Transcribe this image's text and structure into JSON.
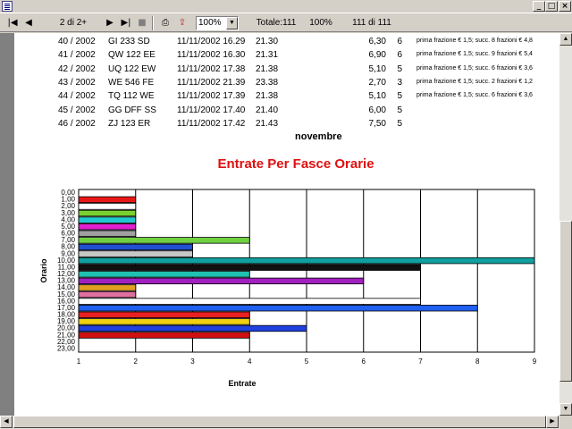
{
  "window": {
    "minimize": "_",
    "maximize": "□",
    "close": "×"
  },
  "toolbar": {
    "first_icon": "first-page-icon",
    "prev_icon": "prev-page-icon",
    "page_indicator": "2 di 2+",
    "next_icon": "next-page-icon",
    "last_icon": "last-page-icon",
    "stop_icon": "stop-icon",
    "print_icon": "print-icon",
    "export_icon": "export-icon",
    "zoom": "100%",
    "total": "Totale:111",
    "percent": "100%",
    "records": "111 di 111"
  },
  "rows": [
    {
      "id": "40 / 2002",
      "plate": "GI 233 SD",
      "datetime": "11/11/2002 16.29",
      "out": "21.30",
      "amount": "6,30",
      "n": "6",
      "note": "prima frazione € 1,5; succ. 8 frazioni € 4,8"
    },
    {
      "id": "41 / 2002",
      "plate": "QW 122 EE",
      "datetime": "11/11/2002 16.30",
      "out": "21.31",
      "amount": "6,90",
      "n": "6",
      "note": "prima frazione € 1,5; succ. 9 frazioni € 5,4"
    },
    {
      "id": "42 / 2002",
      "plate": "UQ 122 EW",
      "datetime": "11/11/2002 17.38",
      "out": "21.38",
      "amount": "5,10",
      "n": "5",
      "note": "prima frazione € 1,5; succ. 6 frazioni € 3,6"
    },
    {
      "id": "43 / 2002",
      "plate": "WE 546 FE",
      "datetime": "11/11/2002 21.39",
      "out": "23.38",
      "amount": "2,70",
      "n": "3",
      "note": "prima frazione € 1,5; succ. 2 frazioni € 1,2"
    },
    {
      "id": "44 / 2002",
      "plate": "TQ 112 WE",
      "datetime": "11/11/2002 17.39",
      "out": "21.38",
      "amount": "5,10",
      "n": "5",
      "note": "prima frazione € 1,5; succ. 6 frazioni € 3,6"
    },
    {
      "id": "45 / 2002",
      "plate": "GG DFF SS",
      "datetime": "11/11/2002 17.40",
      "out": "21.40",
      "amount": "6,00",
      "n": "5",
      "note": ""
    },
    {
      "id": "46 / 2002",
      "plate": "ZJ 123 ER",
      "datetime": "11/11/2002 17.42",
      "out": "21.43",
      "amount": "7,50",
      "n": "5",
      "note": ""
    }
  ],
  "month_label": "novembre",
  "chart_data": {
    "type": "bar",
    "orientation": "horizontal",
    "title": "Entrate Per Fasce Orarie",
    "xlabel": "Entrate",
    "ylabel": "Orario",
    "xlim": [
      1,
      9
    ],
    "xticks": [
      "1",
      "2",
      "3",
      "4",
      "5",
      "6",
      "7",
      "8",
      "9"
    ],
    "grid": true,
    "categories": [
      "0,00",
      "1,00",
      "2,00",
      "3,00",
      "4,00",
      "5,00",
      "6,00",
      "7,00",
      "8,00",
      "9,00",
      "10,00",
      "11,00",
      "12,00",
      "13,00",
      "14,00",
      "15,00",
      "16,00",
      "17,00",
      "18,00",
      "19,00",
      "20,00",
      "21,00",
      "22,00",
      "23,00"
    ],
    "values": [
      0,
      2,
      2,
      2,
      2,
      2,
      2,
      4,
      3,
      3,
      9,
      7,
      4,
      6,
      2,
      2,
      7,
      8,
      4,
      4,
      5,
      4,
      0,
      0
    ],
    "colors": [
      "#ffffff",
      "#e81818",
      "#ffffff",
      "#7ad030",
      "#20c8d0",
      "#e020d0",
      "#a0a0a0",
      "#70d040",
      "#2050d0",
      "#c8c8c8",
      "#10a0a0",
      "#101010",
      "#20c0b0",
      "#a020c0",
      "#e0a020",
      "#e070a0",
      "#ffffff",
      "#2060f0",
      "#e82020",
      "#f0d010",
      "#2040e0",
      "#d01010",
      "#ffffff",
      "#ffffff"
    ]
  }
}
